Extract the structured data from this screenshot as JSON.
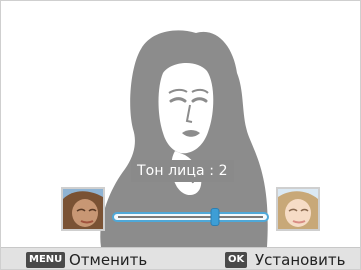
{
  "adjustment": {
    "label": "Тон лица : 2",
    "level": 2,
    "min": 0,
    "max": 4
  },
  "bottom_bar": {
    "cancel_key": "MENU",
    "cancel_label": "Отменить",
    "confirm_key": "OK",
    "confirm_label": "Установить"
  },
  "icons": {
    "face_preview": "face-silhouette-icon",
    "darker_thumb": "darker-skin-thumbnail-icon",
    "lighter_thumb": "lighter-skin-thumbnail-icon"
  },
  "colors": {
    "slider_accent": "#3d9ed6",
    "silhouette": "#8c8c8c",
    "bar_background": "#e2e2e2"
  }
}
